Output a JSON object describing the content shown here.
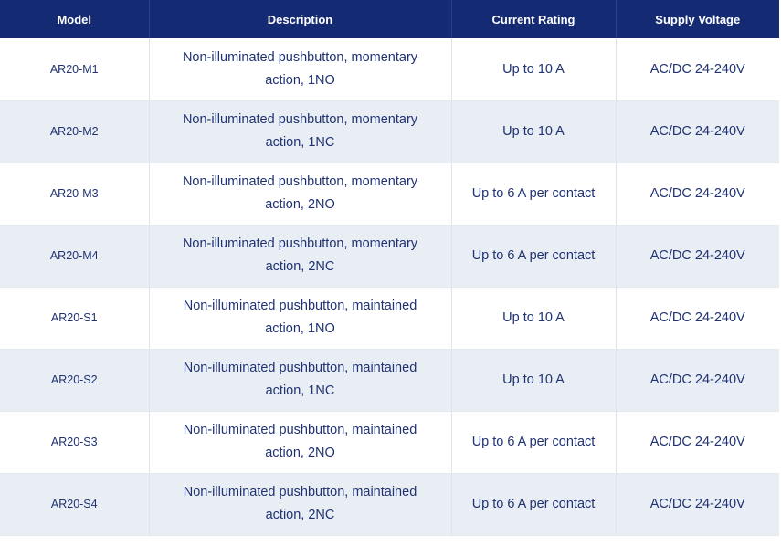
{
  "table": {
    "headers": {
      "model": "Model",
      "description": "Description",
      "current_rating": "Current Rating",
      "supply_voltage": "Supply Voltage"
    },
    "rows": [
      {
        "model": "AR20-M1",
        "description": "Non-illuminated pushbutton, momentary action, 1NO",
        "current_rating": "Up to 10 A",
        "supply_voltage": "AC/DC 24-240V"
      },
      {
        "model": "AR20-M2",
        "description": "Non-illuminated pushbutton, momentary action, 1NC",
        "current_rating": "Up to 10 A",
        "supply_voltage": "AC/DC 24-240V"
      },
      {
        "model": "AR20-M3",
        "description": "Non-illuminated pushbutton, momentary action, 2NO",
        "current_rating": "Up to 6 A per contact",
        "supply_voltage": "AC/DC 24-240V"
      },
      {
        "model": "AR20-M4",
        "description": "Non-illuminated pushbutton, momentary action, 2NC",
        "current_rating": "Up to 6 A per contact",
        "supply_voltage": "AC/DC 24-240V"
      },
      {
        "model": "AR20-S1",
        "description": "Non-illuminated pushbutton, maintained action, 1NO",
        "current_rating": "Up to 10 A",
        "supply_voltage": "AC/DC 24-240V"
      },
      {
        "model": "AR20-S2",
        "description": "Non-illuminated pushbutton, maintained action, 1NC",
        "current_rating": "Up to 10 A",
        "supply_voltage": "AC/DC 24-240V"
      },
      {
        "model": "AR20-S3",
        "description": "Non-illuminated pushbutton, maintained action, 2NO",
        "current_rating": "Up to 6 A per contact",
        "supply_voltage": "AC/DC 24-240V"
      },
      {
        "model": "AR20-S4",
        "description": "Non-illuminated pushbutton, maintained action, 2NC",
        "current_rating": "Up to 6 A per contact",
        "supply_voltage": "AC/DC 24-240V"
      }
    ]
  },
  "colors": {
    "header_bg": "#142a73",
    "header_text": "#ffffff",
    "body_text": "#1f3272",
    "row_alt_bg": "#e9eef5"
  }
}
